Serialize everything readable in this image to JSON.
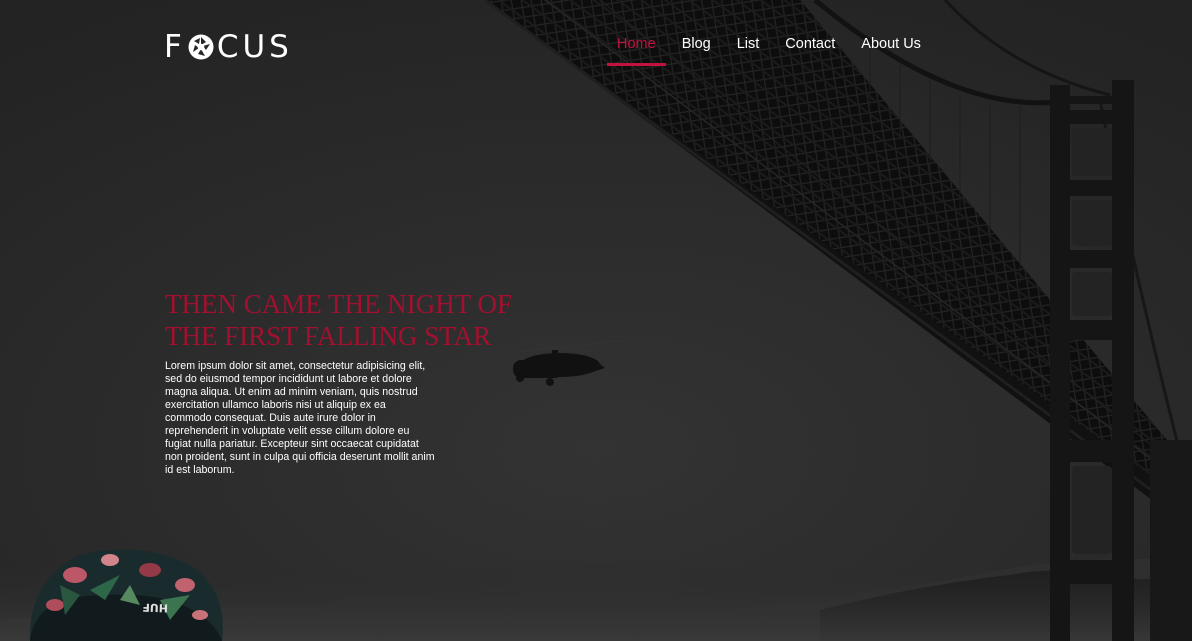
{
  "brand": {
    "logo_pre": "F",
    "logo_post": "CUS",
    "accent_color": "#c4123f"
  },
  "nav": {
    "items": [
      {
        "label": "Home",
        "active": true
      },
      {
        "label": "Blog",
        "active": false
      },
      {
        "label": "List",
        "active": false
      },
      {
        "label": "Contact",
        "active": false
      },
      {
        "label": "About Us",
        "active": false
      }
    ]
  },
  "hero": {
    "headline": "THEN CAME THE NIGHT OF THE FIRST FALLING STAR",
    "body": "Lorem ipsum dolor sit amet, consectetur adipisicing elit, sed do eiusmod tempor incididunt ut labore et dolore magna aliqua. Ut enim ad minim veniam, quis nostrud exercitation ullamco laboris nisi ut aliquip ex ea commodo consequat. Duis aute irure dolor in reprehenderit in voluptate velit esse cillum dolore eu fugiat nulla pariatur. Excepteur sint occaecat cupidatat non proident, sunt in culpa qui officia deserunt mollit anim id est laborum.",
    "cap_text": "HUF"
  }
}
